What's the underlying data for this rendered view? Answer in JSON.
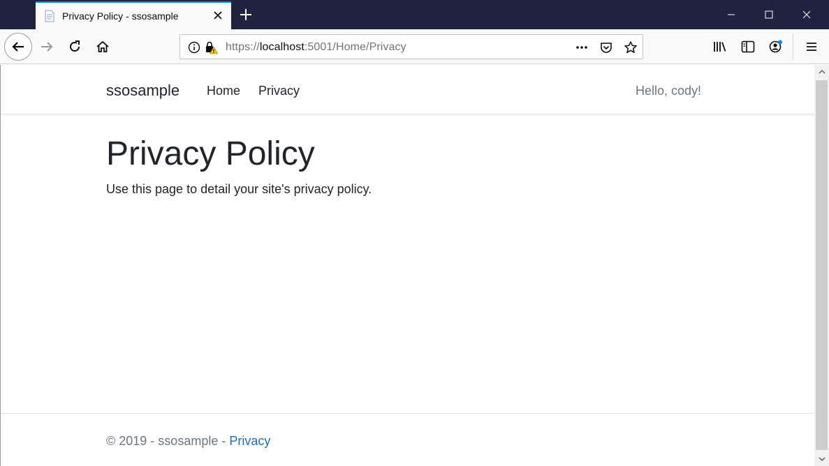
{
  "browser": {
    "tab_title": "Privacy Policy - ssosample",
    "new_tab_symbol": "+",
    "url_scheme": "https://",
    "url_host": "localhost",
    "url_rest": ":5001/Home/Privacy",
    "icons": [
      "file-icon",
      "close-icon",
      "plus-icon",
      "minimize-icon",
      "maximize-icon",
      "window-close-icon",
      "back-arrow-icon",
      "forward-arrow-icon",
      "reload-icon",
      "home-icon",
      "info-icon",
      "lock-warning-icon",
      "more-icon",
      "pocket-icon",
      "star-icon",
      "library-icon",
      "sidebar-icon",
      "account-icon",
      "menu-icon"
    ],
    "accent_color": "#0a84ff",
    "titlebar_color": "#202340"
  },
  "site": {
    "brand": "ssosample",
    "nav": [
      {
        "label": "Home"
      },
      {
        "label": "Privacy"
      }
    ],
    "greeting": "Hello, cody!"
  },
  "main": {
    "title": "Privacy Policy",
    "description": "Use this page to detail your site's privacy policy."
  },
  "footer": {
    "text": "© 2019 - ssosample - ",
    "link": "Privacy",
    "link_color": "#1b6ec2"
  }
}
